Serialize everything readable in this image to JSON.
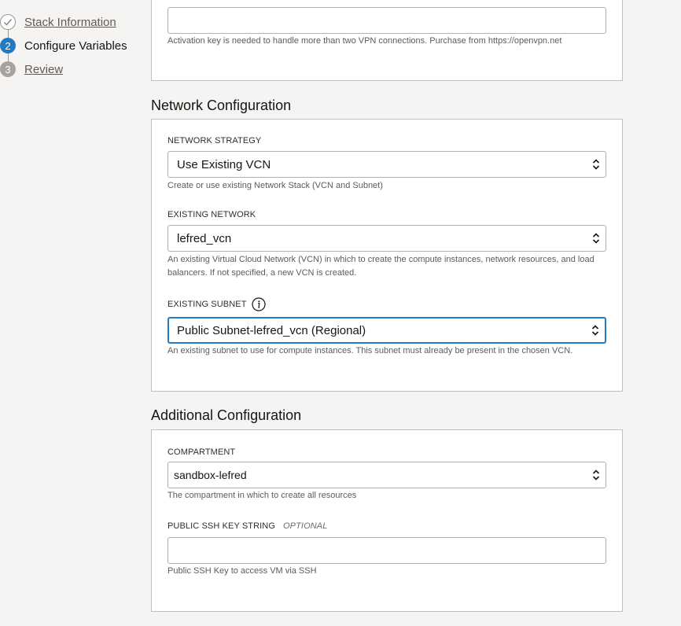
{
  "steps": [
    {
      "number": "",
      "label": "Stack Information",
      "state": "done"
    },
    {
      "number": "2",
      "label": "Configure Variables",
      "state": "current"
    },
    {
      "number": "3",
      "label": "Review",
      "state": "todo"
    }
  ],
  "top_panel": {
    "activation_key_value": "",
    "activation_key_hint": "Activation key is needed to handle more than two VPN connections. Purchase from https://openvpn.net"
  },
  "network": {
    "title": "Network Configuration",
    "strategy_label": "NETWORK STRATEGY",
    "strategy_value": "Use Existing VCN",
    "strategy_hint": "Create or use existing Network Stack (VCN and Subnet)",
    "existing_network_label": "EXISTING NETWORK",
    "existing_network_value": "lefred_vcn",
    "existing_network_hint": "An existing Virtual Cloud Network (VCN) in which to create the compute instances, network resources, and load balancers. If not specified, a new VCN is created.",
    "existing_subnet_label": "EXISTING SUBNET",
    "existing_subnet_value": "Public Subnet-lefred_vcn (Regional)",
    "existing_subnet_hint": "An existing subnet to use for compute instances. This subnet must already be present in the chosen VCN."
  },
  "additional": {
    "title": "Additional Configuration",
    "compartment_label": "COMPARTMENT",
    "compartment_value": "sandbox-lefred",
    "compartment_hint": "The compartment in which to create all resources",
    "ssh_label": "PUBLIC SSH KEY STRING",
    "ssh_optional": "OPTIONAL",
    "ssh_value": "",
    "ssh_hint": "Public SSH Key to access VM via SSH"
  },
  "colors": {
    "accent": "#227ac2",
    "background": "#f5f4f2",
    "border": "#c4bfba"
  },
  "icons": {
    "completed_step": "check-circle-icon",
    "select_arrows": "chevron-up-down-icon",
    "info": "info-icon"
  }
}
